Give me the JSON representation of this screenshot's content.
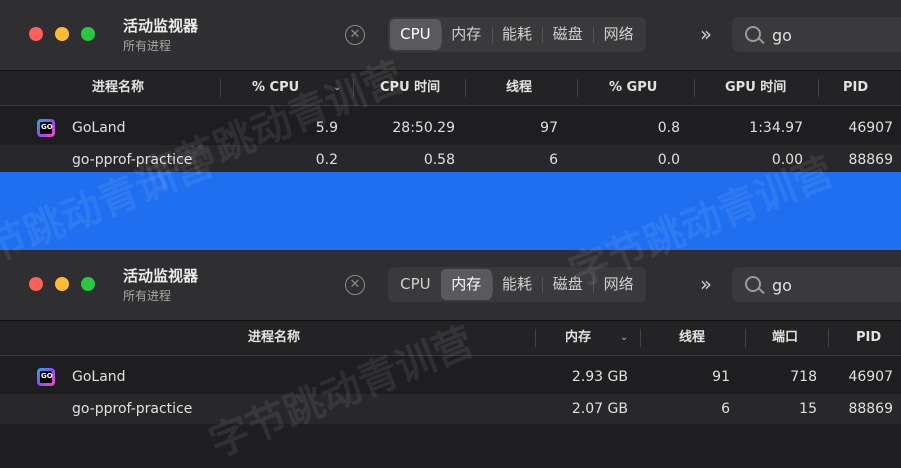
{
  "window1": {
    "title": "活动监视器",
    "subtitle": "所有进程",
    "tabs": [
      "CPU",
      "内存",
      "能耗",
      "磁盘",
      "网络"
    ],
    "active_tab": "CPU",
    "search": {
      "value": "go"
    },
    "columns": {
      "name": "进程名称",
      "cpu_pct": "% CPU",
      "cpu_time": "CPU 时间",
      "threads": "线程",
      "gpu_pct": "% GPU",
      "gpu_time": "GPU 时间",
      "pid": "PID"
    },
    "rows": [
      {
        "name": "GoLand",
        "cpu_pct": "5.9",
        "cpu_time": "28:50.29",
        "threads": "97",
        "gpu_pct": "0.8",
        "gpu_time": "1:34.97",
        "pid": "46907"
      },
      {
        "name": "go-pprof-practice",
        "cpu_pct": "0.2",
        "cpu_time": "0.58",
        "threads": "6",
        "gpu_pct": "0.0",
        "gpu_time": "0.00",
        "pid": "88869"
      }
    ]
  },
  "window2": {
    "title": "活动监视器",
    "subtitle": "所有进程",
    "tabs": [
      "CPU",
      "内存",
      "能耗",
      "磁盘",
      "网络"
    ],
    "active_tab": "内存",
    "search": {
      "value": "go"
    },
    "columns": {
      "name": "进程名称",
      "memory": "内存",
      "threads": "线程",
      "ports": "端口",
      "pid": "PID"
    },
    "rows": [
      {
        "name": "GoLand",
        "memory": "2.93 GB",
        "threads": "91",
        "ports": "718",
        "pid": "46907"
      },
      {
        "name": "go-pprof-practice",
        "memory": "2.07 GB",
        "threads": "6",
        "ports": "15",
        "pid": "88869"
      }
    ]
  },
  "app_icon_text": "GO",
  "watermark_text": "字节跳动青训营",
  "colors": {
    "accent_divider": "#1f6ff0",
    "toolbar": "#2f2f32",
    "table_bg": "#1e1e20"
  }
}
